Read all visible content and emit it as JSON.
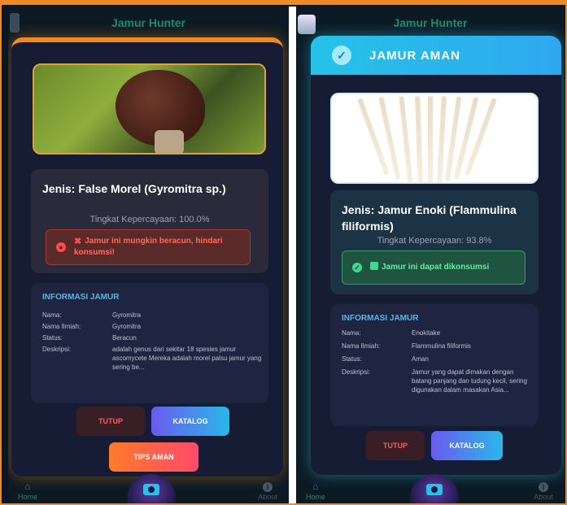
{
  "screens": [
    {
      "header_title": "Jamur Hunter",
      "species": "Jenis: False Morel (Gyromitra sp.)",
      "confidence": "Tingkat Kepercayaan: 100.0%",
      "alert_icon": "x-mark",
      "alert_text": "Jamur ini mungkin beracun, hindari konsumsi!",
      "details": {
        "title": "INFORMASI JAMUR",
        "rows": [
          {
            "key": "Nama:",
            "value": "Gyromitra"
          },
          {
            "key": "Nama Ilmiah:",
            "value": "Gyromitra"
          },
          {
            "key": "Status:",
            "value": "Beracun"
          },
          {
            "key": "Deskripsi:",
            "value": "adalah genus dari sekitar 18 spesies jamur ascomycete Mereka adalah morel palsu jamur yang sering be..."
          }
        ]
      },
      "buttons": {
        "close": "TUTUP",
        "catalog": "KATALOG",
        "tips": "TIPS AMAN"
      },
      "nav": {
        "home": "Home",
        "about": "About"
      }
    },
    {
      "header_title": "Jamur Hunter",
      "result_title": "JAMUR AMAN",
      "species": "Jenis: Jamur Enoki (Flammulina filiformis)",
      "confidence": "Tingkat Kepercayaan: 93.8%",
      "alert_icon": "checkbox",
      "alert_text": "Jamur ini dapat dikonsumsi",
      "details": {
        "title": "INFORMASI JAMUR",
        "rows": [
          {
            "key": "Nama:",
            "value": "Enokitake"
          },
          {
            "key": "Nama Ilmiah:",
            "value": "Flammulina filiformis"
          },
          {
            "key": "Status:",
            "value": "Aman"
          },
          {
            "key": "Deskripsi:",
            "value": "Jamur yang dapat dimakan dengan batang panjang dan tudung kecil, sering digunakan dalam masakan Asia..."
          }
        ]
      },
      "buttons": {
        "close": "TUTUP",
        "catalog": "KATALOG"
      },
      "nav": {
        "home": "Home",
        "about": "About"
      }
    }
  ],
  "colors": {
    "frame": "#f08a24",
    "toxic_alert": "#a33838",
    "safe_alert": "#3c9a6a",
    "success_header": "#26c2e8",
    "accent": "#5ab4e8"
  },
  "icons": [
    "close-icon",
    "x-mark-icon",
    "check-icon",
    "checkbox-icon",
    "home-icon",
    "camera-icon",
    "info-icon"
  ]
}
